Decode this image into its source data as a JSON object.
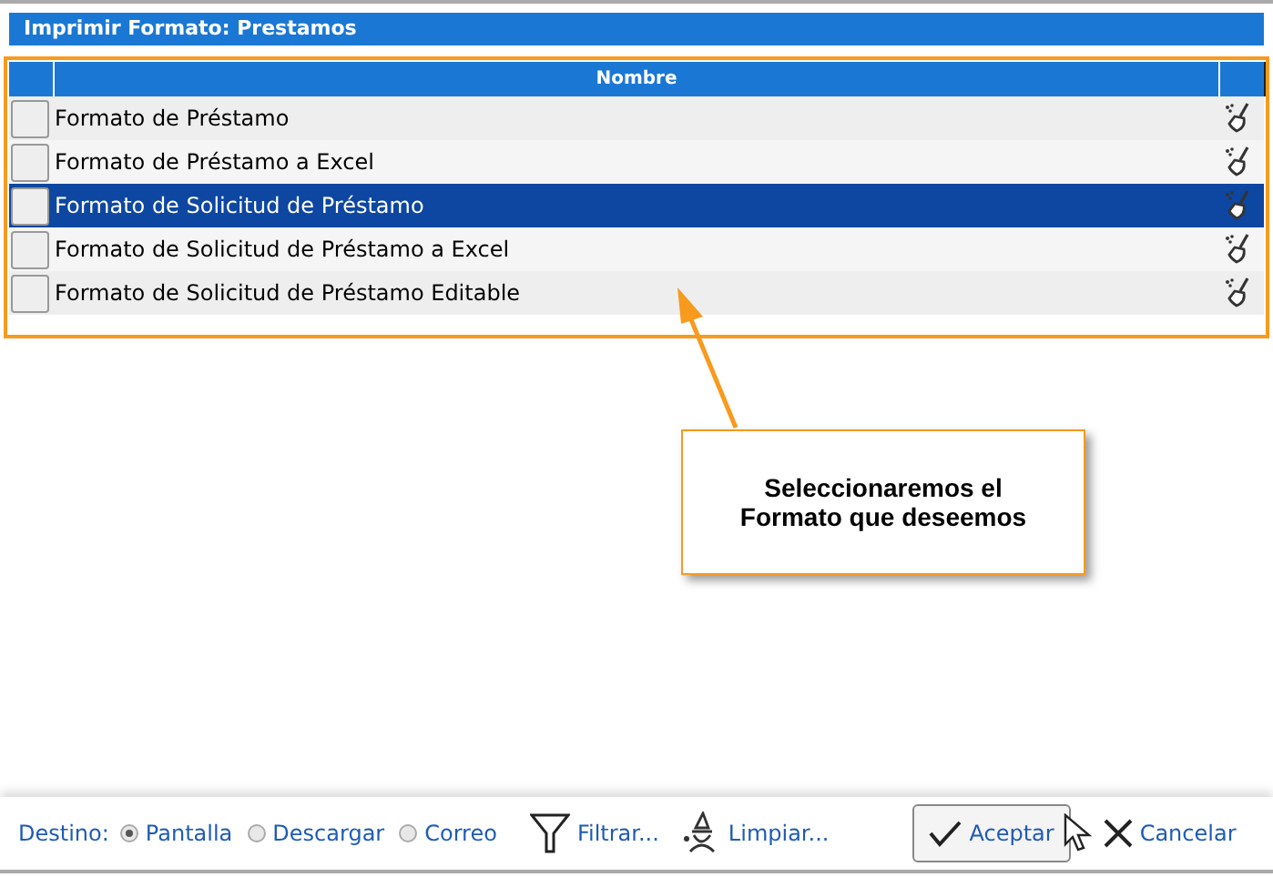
{
  "window": {
    "title": "Imprimir Formato: Prestamos"
  },
  "table": {
    "columns": [
      "Nombre"
    ],
    "rows": [
      {
        "name": "Formato de Préstamo",
        "selected": false
      },
      {
        "name": "Formato de Préstamo a Excel",
        "selected": false
      },
      {
        "name": "Formato de Solicitud de Préstamo",
        "selected": true
      },
      {
        "name": "Formato de Solicitud de Préstamo a Excel",
        "selected": false
      },
      {
        "name": "Formato de Solicitud de Préstamo Editable",
        "selected": false
      }
    ]
  },
  "callout": {
    "text": "Seleccionaremos el Formato que deseemos"
  },
  "footer": {
    "destination_label": "Destino:",
    "destinations": [
      {
        "label": "Pantalla",
        "selected": true
      },
      {
        "label": "Descargar",
        "selected": false
      },
      {
        "label": "Correo",
        "selected": false
      }
    ],
    "filter": "Filtrar...",
    "clear": "Limpiar...",
    "accept": "Aceptar",
    "cancel": "Cancelar"
  }
}
